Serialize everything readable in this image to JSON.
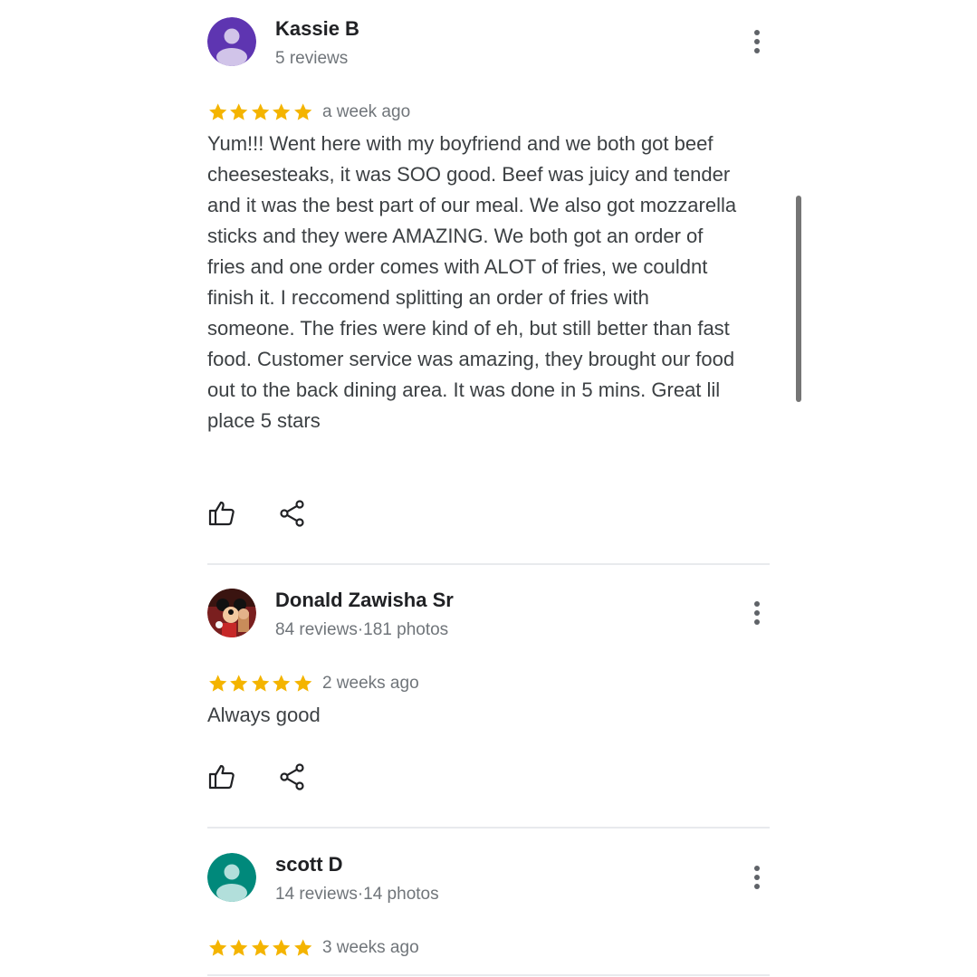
{
  "colors": {
    "star": "#f4b400",
    "text": "#3c4043",
    "name": "#202124",
    "meta": "#70757a",
    "avatar_purple": "#5e35b1",
    "avatar_teal": "#00897b",
    "divider": "#e8eaed"
  },
  "reviews": [
    {
      "author": "Kassie B",
      "meta": "5 reviews",
      "avatar_icon": "default-person-avatar-icon",
      "rating": 5,
      "time": "a week ago",
      "text": "Yum!!! Went here with my boyfriend and we both got beef cheesesteaks, it was SOO good. Beef was juicy and tender and it was the best part of our meal. We also got mozzarella sticks and they were AMAZING. We both got an order of fries and one order comes with ALOT of fries, we couldnt finish it. I reccomend splitting an order of fries with someone. The fries were kind of eh, but still better than fast food. Customer service was amazing, they brought our food out to the back dining area. It was done in 5 mins. Great lil place 5 stars"
    },
    {
      "author": "Donald Zawisha Sr",
      "meta": "84 reviews·181 photos",
      "avatar_icon": "mickey-mouse-photo-avatar",
      "rating": 5,
      "time": "2 weeks ago",
      "text": "Always good"
    },
    {
      "author": "scott D",
      "meta": "14 reviews·14 photos",
      "avatar_icon": "default-person-avatar-icon",
      "rating": 5,
      "time": "3 weeks ago",
      "text": ""
    }
  ],
  "icons": {
    "like": "thumbs-up-icon",
    "share": "share-icon",
    "more": "more-vert-icon",
    "star": "star-icon"
  }
}
